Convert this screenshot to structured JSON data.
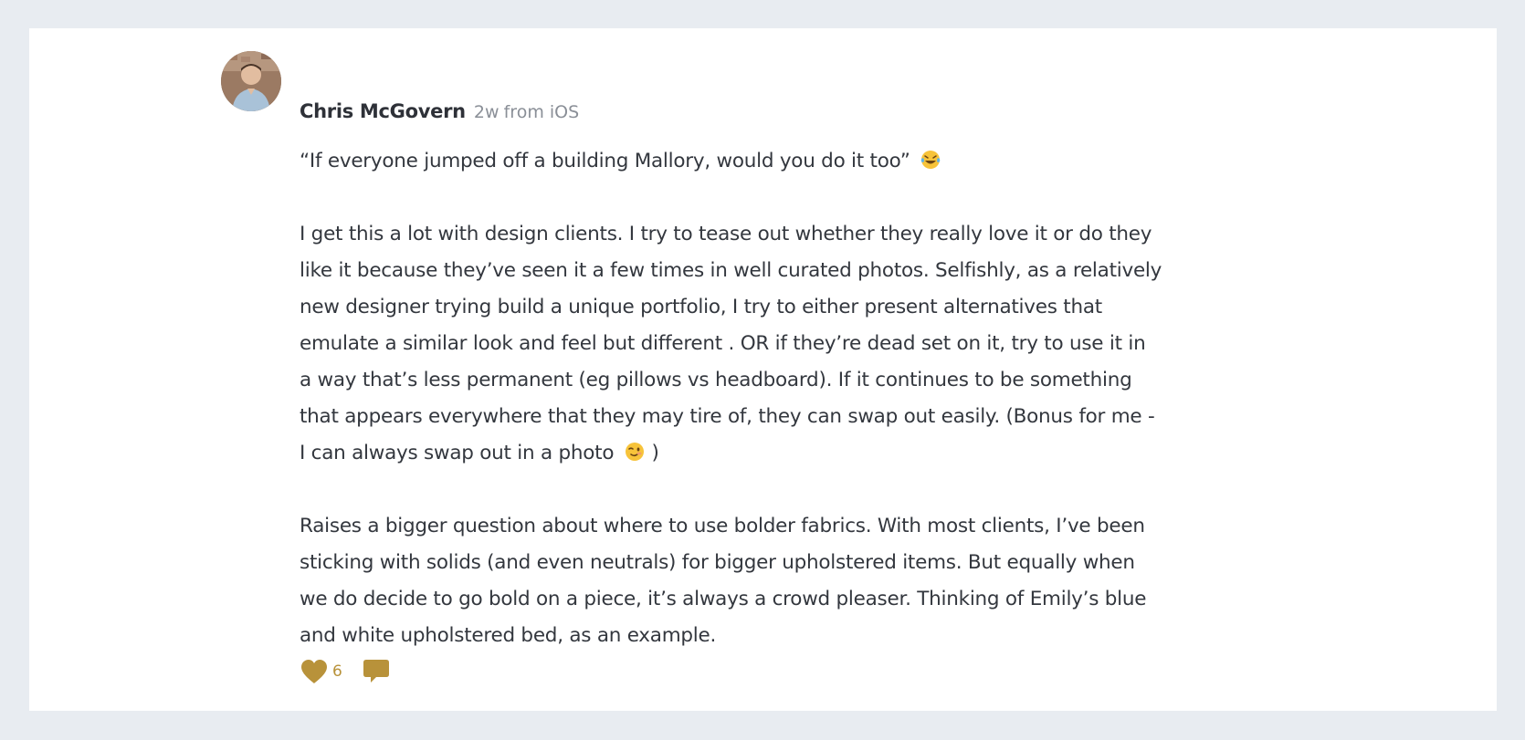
{
  "post": {
    "author": "Chris McGovern",
    "time": "2w",
    "source": "from iOS",
    "paragraphs": [
      [
        "“If everyone jumped off a building Mallory, would you do it too”"
      ],
      [
        "I get this a lot with design clients. I try to tease out whether they really love it or do they",
        "like it because they’ve seen it a few times in well curated photos. Selfishly, as a relatively",
        "new designer trying build a unique portfolio, I try to either present alternatives that",
        "emulate a similar look and feel but different . OR if they’re dead set on it, try to use it in",
        "a way that’s less permanent (eg pillows vs headboard). If it continues to be something",
        "that appears everywhere that they may tire of, they can swap out easily. (Bonus for me -",
        "I can always swap out in a photo",
        ")"
      ],
      [
        "Raises a bigger question about where to use bolder fabrics. With most clients, I’ve been",
        "sticking with solids (and even neutrals) for bigger upholstered items. But equally when",
        "we do decide to go bold on a piece, it’s always a crowd pleaser. Thinking of Emily’s blue",
        "and white upholstered bed, as an example."
      ]
    ],
    "emojis": [
      "laughing-tears-emoji",
      "winking-face-emoji"
    ],
    "likes": "6"
  },
  "icons": {
    "like": "heart-icon",
    "comment": "speech-bubble-icon"
  },
  "colors": {
    "page_background": "#e8ecf1",
    "card_background": "#ffffff",
    "accent_gold": "#b8923a",
    "text": "#33373e",
    "muted": "#8a8f97"
  }
}
